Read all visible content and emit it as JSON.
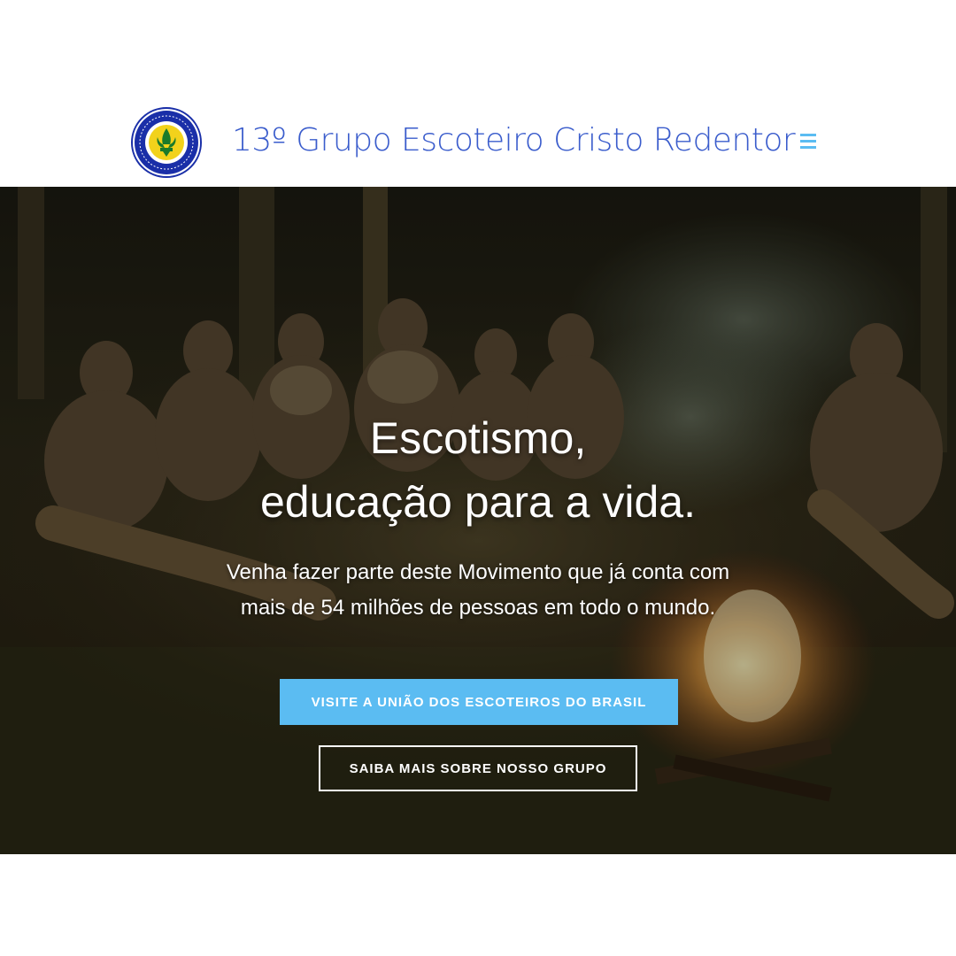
{
  "header": {
    "site_title": "13º Grupo Escoteiro Cristo Redentor",
    "logo": "scout-group-emblem",
    "menu_icon": "hamburger-menu-icon"
  },
  "hero": {
    "background": "scouts-around-campfire-photo",
    "title_line1": "Escotismo,",
    "title_line2": "educação para a vida.",
    "description": "Venha fazer parte deste Movimento que já conta com mais de 54 milhões de pessoas em todo o mundo.",
    "primary_button": "VISITE A UNIÃO DOS ESCOTEIROS DO BRASIL",
    "secondary_button": "SAIBA MAIS SOBRE NOSSO GRUPO"
  },
  "colors": {
    "accent": "#5bbcf2",
    "title_blue": "#3a5ccc",
    "logo_navy": "#1a2fa8",
    "logo_yellow": "#f2d21b"
  }
}
